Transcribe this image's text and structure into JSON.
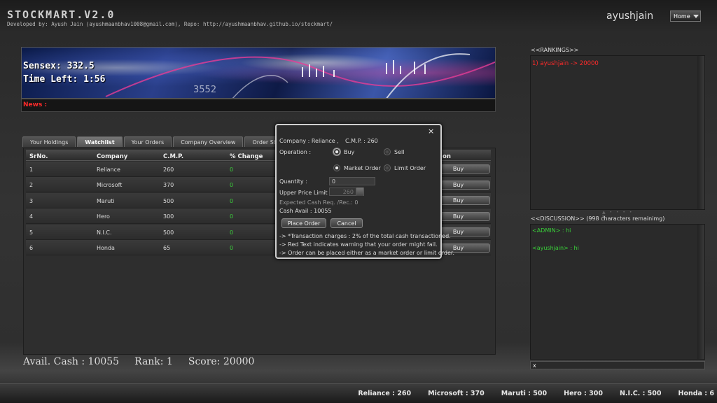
{
  "header": {
    "logo": "STOCKMART.V2.0",
    "developer_line": "Developed by: Ayush Jain (ayushmaanbhav1008@gmail.com), Repo: http://ayushmaanbhav.github.io/stockmart/",
    "username": "ayushjain",
    "home_button": "Home"
  },
  "banner": {
    "sensex": "Sensex: 332.5",
    "time_left": "Time Left: 1:56",
    "news_label": "News :"
  },
  "tabs": [
    {
      "label": "Your Holdings"
    },
    {
      "label": "Watchlist"
    },
    {
      "label": "Your Orders"
    },
    {
      "label": "Company Overview"
    },
    {
      "label": "Order Stats"
    }
  ],
  "table": {
    "headers": {
      "srno": "SrNo.",
      "company": "Company",
      "cmp": "C.M.P.",
      "change": "% Change",
      "action": "on"
    },
    "rows": [
      {
        "srno": "1",
        "company": "Reliance",
        "cmp": "260",
        "change": "0",
        "action": "Buy"
      },
      {
        "srno": "2",
        "company": "Microsoft",
        "cmp": "370",
        "change": "0",
        "action": "Buy"
      },
      {
        "srno": "3",
        "company": "Maruti",
        "cmp": "500",
        "change": "0",
        "action": "Buy"
      },
      {
        "srno": "4",
        "company": "Hero",
        "cmp": "300",
        "change": "0",
        "action": "Buy"
      },
      {
        "srno": "5",
        "company": "N.I.C.",
        "cmp": "500",
        "change": "0",
        "action": "Buy"
      },
      {
        "srno": "6",
        "company": "Honda",
        "cmp": "65",
        "change": "0",
        "action": "Buy"
      }
    ]
  },
  "stats": {
    "cash": "Avail. Cash : 10055",
    "rank": "Rank: 1",
    "score": "Score: 20000"
  },
  "rankings": {
    "title": "<<RANKINGS>>",
    "entries": [
      "1) ayushjain -> 20000"
    ]
  },
  "discussion": {
    "title": "<<DISCUSSION>> (998 characters remainimg)",
    "messages": [
      "<ADMIN> : hi",
      "<ayushjain> : hi"
    ],
    "input_value": "x"
  },
  "ticker": [
    "Reliance : 260",
    "Microsoft : 370",
    "Maruti : 500",
    "Hero : 300",
    "N.I.C. : 500",
    "Honda : 6"
  ],
  "dialog": {
    "close": "×",
    "company_line": "Company : Reliance ,",
    "cmp_line": "C.M.P. : 260",
    "operation_label": "Operation :",
    "buy": "Buy",
    "sell": "Sell",
    "market_order": "Market Order",
    "limit_order": "Limit Order",
    "quantity_label": "Quantity :",
    "quantity_value": "0",
    "upper_price_label": "Upper Price Limit :",
    "upper_price_value": "260",
    "expected_cash": "Expected Cash Req. /Rec.: 0",
    "cash_avail": "Cash Avail : 10055",
    "place_order": "Place Order",
    "cancel": "Cancel",
    "notes": [
      "-> *Transaction charges : 2% of the total cash transactioned.",
      "-> Red Text indicates warning that your order might fail.",
      "-> Order can be placed either as a market order or limit order."
    ]
  }
}
